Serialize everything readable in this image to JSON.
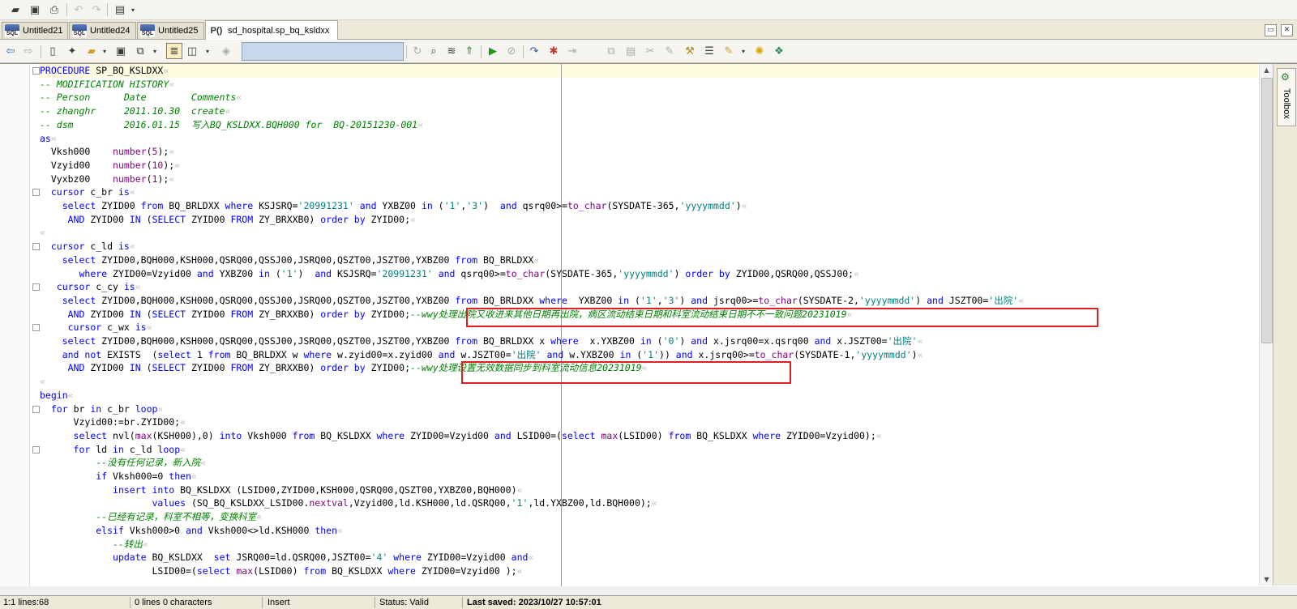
{
  "tabs": [
    {
      "label": "Untitled21",
      "type": "SQL"
    },
    {
      "label": "Untitled24",
      "type": "SQL"
    },
    {
      "label": "Untitled25",
      "type": "SQL"
    },
    {
      "label": "sd_hospital.sp_bq_ksldxx",
      "type": "P()"
    }
  ],
  "side_panel": {
    "toolbox_label": "Toolbox"
  },
  "status": {
    "position": "1:1 lines:68",
    "selection": "0 lines 0 characters",
    "mode": "Insert",
    "validity": "Status: Valid",
    "last_saved": "Last saved: 2023/10/27 10:57:01"
  },
  "code_lines": [
    {
      "segments": [
        {
          "t": "PROCEDURE",
          "c": "kw"
        },
        {
          "t": " SP_BQ_KSLDXX"
        },
        {
          "t": "«",
          "c": "para"
        }
      ]
    },
    {
      "segments": [
        {
          "t": "-- MODIFICATION HISTORY",
          "c": "cm"
        },
        {
          "t": "«",
          "c": "para"
        }
      ]
    },
    {
      "segments": [
        {
          "t": "-- Person      Date        Comments",
          "c": "cm"
        },
        {
          "t": "«",
          "c": "para"
        }
      ]
    },
    {
      "segments": [
        {
          "t": "-- zhanghr     2011.10.30  create",
          "c": "cm"
        },
        {
          "t": "«",
          "c": "para"
        }
      ]
    },
    {
      "segments": [
        {
          "t": "-- dsm         2016.01.15  写入BQ_KSLDXX.BQH000 for  BQ-20151230-001",
          "c": "cm"
        },
        {
          "t": "«",
          "c": "para"
        }
      ]
    },
    {
      "segments": [
        {
          "t": "as",
          "c": "kw"
        },
        {
          "t": "«",
          "c": "para"
        }
      ]
    },
    {
      "segments": [
        {
          "t": "  Vksh000    "
        },
        {
          "t": "number",
          "c": "fn"
        },
        {
          "t": "("
        },
        {
          "t": "5",
          "c": "num"
        },
        {
          "t": ");"
        },
        {
          "t": "«",
          "c": "para"
        }
      ]
    },
    {
      "segments": [
        {
          "t": "  Vzyid00    "
        },
        {
          "t": "number",
          "c": "fn"
        },
        {
          "t": "("
        },
        {
          "t": "10",
          "c": "num"
        },
        {
          "t": ");"
        },
        {
          "t": "«",
          "c": "para"
        }
      ]
    },
    {
      "segments": [
        {
          "t": "  Vyxbz00    "
        },
        {
          "t": "number",
          "c": "fn"
        },
        {
          "t": "("
        },
        {
          "t": "1",
          "c": "num"
        },
        {
          "t": ");"
        },
        {
          "t": "«",
          "c": "para"
        }
      ]
    },
    {
      "segments": [
        {
          "t": "  "
        },
        {
          "t": "cursor",
          "c": "kw"
        },
        {
          "t": " c_br "
        },
        {
          "t": "is",
          "c": "kw"
        },
        {
          "t": "«",
          "c": "para"
        }
      ]
    },
    {
      "segments": [
        {
          "t": "    "
        },
        {
          "t": "select",
          "c": "kw"
        },
        {
          "t": " ZYID00 "
        },
        {
          "t": "from",
          "c": "kw"
        },
        {
          "t": " BQ_BRLDXX "
        },
        {
          "t": "where",
          "c": "kw"
        },
        {
          "t": " KSJSRQ="
        },
        {
          "t": "'20991231'",
          "c": "str"
        },
        {
          "t": " "
        },
        {
          "t": "and",
          "c": "kw"
        },
        {
          "t": " YXBZ00 "
        },
        {
          "t": "in",
          "c": "kw"
        },
        {
          "t": " ("
        },
        {
          "t": "'1'",
          "c": "str"
        },
        {
          "t": ","
        },
        {
          "t": "'3'",
          "c": "str"
        },
        {
          "t": ")  "
        },
        {
          "t": "and",
          "c": "kw"
        },
        {
          "t": " qsrq00>="
        },
        {
          "t": "to_char",
          "c": "fn"
        },
        {
          "t": "(SYSDATE-365,"
        },
        {
          "t": "'yyyymmdd'",
          "c": "str"
        },
        {
          "t": ")"
        },
        {
          "t": "«",
          "c": "para"
        }
      ]
    },
    {
      "segments": [
        {
          "t": "     "
        },
        {
          "t": "AND",
          "c": "kw"
        },
        {
          "t": " ZYID00 "
        },
        {
          "t": "IN",
          "c": "kw"
        },
        {
          "t": " ("
        },
        {
          "t": "SELECT",
          "c": "kw"
        },
        {
          "t": " ZYID00 "
        },
        {
          "t": "FROM",
          "c": "kw"
        },
        {
          "t": " ZY_BRXXB0) "
        },
        {
          "t": "order by",
          "c": "kw"
        },
        {
          "t": " ZYID00;"
        },
        {
          "t": "«",
          "c": "para"
        }
      ]
    },
    {
      "segments": [
        {
          "t": "«",
          "c": "para"
        }
      ]
    },
    {
      "segments": [
        {
          "t": "  "
        },
        {
          "t": "cursor",
          "c": "kw"
        },
        {
          "t": " c_ld "
        },
        {
          "t": "is",
          "c": "kw"
        },
        {
          "t": "«",
          "c": "para"
        }
      ]
    },
    {
      "segments": [
        {
          "t": "    "
        },
        {
          "t": "select",
          "c": "kw"
        },
        {
          "t": " ZYID00,BQH000,KSH000,QSRQ00,QSSJ00,JSRQ00,QSZT00,JSZT00,YXBZ00 "
        },
        {
          "t": "from",
          "c": "kw"
        },
        {
          "t": " BQ_BRLDXX"
        },
        {
          "t": "«",
          "c": "para"
        }
      ]
    },
    {
      "segments": [
        {
          "t": "       "
        },
        {
          "t": "where",
          "c": "kw"
        },
        {
          "t": " ZYID00=Vzyid00 "
        },
        {
          "t": "and",
          "c": "kw"
        },
        {
          "t": " YXBZ00 "
        },
        {
          "t": "in",
          "c": "kw"
        },
        {
          "t": " ("
        },
        {
          "t": "'1'",
          "c": "str"
        },
        {
          "t": ")  "
        },
        {
          "t": "and",
          "c": "kw"
        },
        {
          "t": " KSJSRQ="
        },
        {
          "t": "'20991231'",
          "c": "str"
        },
        {
          "t": " "
        },
        {
          "t": "and",
          "c": "kw"
        },
        {
          "t": " qsrq00>="
        },
        {
          "t": "to_char",
          "c": "fn"
        },
        {
          "t": "(SYSDATE-365,"
        },
        {
          "t": "'yyyymmdd'",
          "c": "str"
        },
        {
          "t": ") "
        },
        {
          "t": "order by",
          "c": "kw"
        },
        {
          "t": " ZYID00,QSRQ00,QSSJ00;"
        },
        {
          "t": "«",
          "c": "para"
        }
      ]
    },
    {
      "segments": [
        {
          "t": "   "
        },
        {
          "t": "cursor",
          "c": "kw"
        },
        {
          "t": " c_cy "
        },
        {
          "t": "is",
          "c": "kw"
        },
        {
          "t": "«",
          "c": "para"
        }
      ]
    },
    {
      "segments": [
        {
          "t": "    "
        },
        {
          "t": "select",
          "c": "kw"
        },
        {
          "t": " ZYID00,BQH000,KSH000,QSRQ00,QSSJ00,JSRQ00,QSZT00,JSZT00,YXBZ00 "
        },
        {
          "t": "from",
          "c": "kw"
        },
        {
          "t": " BQ_BRLDXX "
        },
        {
          "t": "where",
          "c": "kw"
        },
        {
          "t": "  YXBZ00 "
        },
        {
          "t": "in",
          "c": "kw"
        },
        {
          "t": " ("
        },
        {
          "t": "'1'",
          "c": "str"
        },
        {
          "t": ","
        },
        {
          "t": "'3'",
          "c": "str"
        },
        {
          "t": ") "
        },
        {
          "t": "and",
          "c": "kw"
        },
        {
          "t": " jsrq00>="
        },
        {
          "t": "to_char",
          "c": "fn"
        },
        {
          "t": "(SYSDATE-2,"
        },
        {
          "t": "'yyyymmdd'",
          "c": "str"
        },
        {
          "t": ") "
        },
        {
          "t": "and",
          "c": "kw"
        },
        {
          "t": " JSZT00="
        },
        {
          "t": "'出院'",
          "c": "str"
        },
        {
          "t": "«",
          "c": "para"
        }
      ]
    },
    {
      "segments": [
        {
          "t": "     "
        },
        {
          "t": "AND",
          "c": "kw"
        },
        {
          "t": " ZYID00 "
        },
        {
          "t": "IN",
          "c": "kw"
        },
        {
          "t": " ("
        },
        {
          "t": "SELECT",
          "c": "kw"
        },
        {
          "t": " ZYID00 "
        },
        {
          "t": "FROM",
          "c": "kw"
        },
        {
          "t": " ZY_BRXXB0) "
        },
        {
          "t": "order by",
          "c": "kw"
        },
        {
          "t": " ZYID00;"
        },
        {
          "t": "--wwy处理出院又收进来其他日期再出院，病区流动结束日期和科室流动结束日期不不一致问题20231019",
          "c": "cm"
        },
        {
          "t": "«",
          "c": "para"
        }
      ]
    },
    {
      "segments": [
        {
          "t": "     "
        },
        {
          "t": "cursor",
          "c": "kw"
        },
        {
          "t": " c_wx "
        },
        {
          "t": "is",
          "c": "kw"
        },
        {
          "t": "«",
          "c": "para"
        }
      ]
    },
    {
      "segments": [
        {
          "t": "    "
        },
        {
          "t": "select",
          "c": "kw"
        },
        {
          "t": " ZYID00,BQH000,KSH000,QSRQ00,QSSJ00,JSRQ00,QSZT00,JSZT00,YXBZ00 "
        },
        {
          "t": "from",
          "c": "kw"
        },
        {
          "t": " BQ_BRLDXX x "
        },
        {
          "t": "where",
          "c": "kw"
        },
        {
          "t": "  x.YXBZ00 "
        },
        {
          "t": "in",
          "c": "kw"
        },
        {
          "t": " ("
        },
        {
          "t": "'0'",
          "c": "str"
        },
        {
          "t": ") "
        },
        {
          "t": "and",
          "c": "kw"
        },
        {
          "t": " x.jsrq00=x.qsrq00 "
        },
        {
          "t": "and",
          "c": "kw"
        },
        {
          "t": " x.JSZT00="
        },
        {
          "t": "'出院'",
          "c": "str"
        },
        {
          "t": "«",
          "c": "para"
        }
      ]
    },
    {
      "segments": [
        {
          "t": "    "
        },
        {
          "t": "and not",
          "c": "kw"
        },
        {
          "t": " EXISTS  ("
        },
        {
          "t": "select",
          "c": "kw"
        },
        {
          "t": " 1 "
        },
        {
          "t": "from",
          "c": "kw"
        },
        {
          "t": " BQ_BRLDXX w "
        },
        {
          "t": "where",
          "c": "kw"
        },
        {
          "t": " w.zyid00=x.zyid00 "
        },
        {
          "t": "and",
          "c": "kw"
        },
        {
          "t": " w.JSZT00="
        },
        {
          "t": "'出院'",
          "c": "str"
        },
        {
          "t": " "
        },
        {
          "t": "and",
          "c": "kw"
        },
        {
          "t": " w.YXBZ00 "
        },
        {
          "t": "in",
          "c": "kw"
        },
        {
          "t": " ("
        },
        {
          "t": "'1'",
          "c": "str"
        },
        {
          "t": ")) "
        },
        {
          "t": "and",
          "c": "kw"
        },
        {
          "t": " x.jsrq00>="
        },
        {
          "t": "to_char",
          "c": "fn"
        },
        {
          "t": "(SYSDATE-1,"
        },
        {
          "t": "'yyyymmdd'",
          "c": "str"
        },
        {
          "t": ")"
        },
        {
          "t": "«",
          "c": "para"
        }
      ]
    },
    {
      "segments": [
        {
          "t": "     "
        },
        {
          "t": "AND",
          "c": "kw"
        },
        {
          "t": " ZYID00 "
        },
        {
          "t": "IN",
          "c": "kw"
        },
        {
          "t": " ("
        },
        {
          "t": "SELECT",
          "c": "kw"
        },
        {
          "t": " ZYID00 "
        },
        {
          "t": "FROM",
          "c": "kw"
        },
        {
          "t": " ZY_BRXXB0) "
        },
        {
          "t": "order by",
          "c": "kw"
        },
        {
          "t": " ZYID00;"
        },
        {
          "t": "--wwy处理设置无效数据同步到科室流动信息20231019",
          "c": "cm"
        },
        {
          "t": "«",
          "c": "para"
        }
      ]
    },
    {
      "segments": [
        {
          "t": "«",
          "c": "para"
        }
      ]
    },
    {
      "segments": [
        {
          "t": "begin",
          "c": "kw"
        },
        {
          "t": "«",
          "c": "para"
        }
      ]
    },
    {
      "segments": [
        {
          "t": "  "
        },
        {
          "t": "for",
          "c": "kw"
        },
        {
          "t": " br "
        },
        {
          "t": "in",
          "c": "kw"
        },
        {
          "t": " c_br "
        },
        {
          "t": "loop",
          "c": "kw"
        },
        {
          "t": "«",
          "c": "para"
        }
      ]
    },
    {
      "segments": [
        {
          "t": "      Vzyid00:=br.ZYID00;"
        },
        {
          "t": "«",
          "c": "para"
        }
      ]
    },
    {
      "segments": [
        {
          "t": "      "
        },
        {
          "t": "select",
          "c": "kw"
        },
        {
          "t": " nvl("
        },
        {
          "t": "max",
          "c": "fn"
        },
        {
          "t": "(KSH000),0) "
        },
        {
          "t": "into",
          "c": "kw"
        },
        {
          "t": " Vksh000 "
        },
        {
          "t": "from",
          "c": "kw"
        },
        {
          "t": " BQ_KSLDXX "
        },
        {
          "t": "where",
          "c": "kw"
        },
        {
          "t": " ZYID00=Vzyid00 "
        },
        {
          "t": "and",
          "c": "kw"
        },
        {
          "t": " LSID00=("
        },
        {
          "t": "select",
          "c": "kw"
        },
        {
          "t": " "
        },
        {
          "t": "max",
          "c": "fn"
        },
        {
          "t": "(LSID00) "
        },
        {
          "t": "from",
          "c": "kw"
        },
        {
          "t": " BQ_KSLDXX "
        },
        {
          "t": "where",
          "c": "kw"
        },
        {
          "t": " ZYID00=Vzyid00);"
        },
        {
          "t": "«",
          "c": "para"
        }
      ]
    },
    {
      "segments": [
        {
          "t": "      "
        },
        {
          "t": "for",
          "c": "kw"
        },
        {
          "t": " ld "
        },
        {
          "t": "in",
          "c": "kw"
        },
        {
          "t": " c_ld "
        },
        {
          "t": "loop",
          "c": "kw"
        },
        {
          "t": "«",
          "c": "para"
        }
      ]
    },
    {
      "segments": [
        {
          "t": "          "
        },
        {
          "t": "--没有任何记录，新入院",
          "c": "cm"
        },
        {
          "t": "«",
          "c": "para"
        }
      ]
    },
    {
      "segments": [
        {
          "t": "          "
        },
        {
          "t": "if",
          "c": "kw"
        },
        {
          "t": " Vksh000=0 "
        },
        {
          "t": "then",
          "c": "kw"
        },
        {
          "t": "«",
          "c": "para"
        }
      ]
    },
    {
      "segments": [
        {
          "t": "             "
        },
        {
          "t": "insert into",
          "c": "kw"
        },
        {
          "t": " BQ_KSLDXX (LSID00,ZYID00,KSH000,QSRQ00,QSZT00,YXBZ00,BQH000)"
        },
        {
          "t": "«",
          "c": "para"
        }
      ]
    },
    {
      "segments": [
        {
          "t": "                    "
        },
        {
          "t": "values",
          "c": "kw"
        },
        {
          "t": " (SQ_BQ_KSLDXX_LSID00."
        },
        {
          "t": "nextval",
          "c": "fn"
        },
        {
          "t": ",Vzyid00,ld.KSH000,ld.QSRQ00,"
        },
        {
          "t": "'1'",
          "c": "str"
        },
        {
          "t": ",ld.YXBZ00,ld.BQH000);"
        },
        {
          "t": "«",
          "c": "para"
        }
      ]
    },
    {
      "segments": [
        {
          "t": "          "
        },
        {
          "t": "--已经有记录，科室不相等，变换科室",
          "c": "cm"
        },
        {
          "t": "«",
          "c": "para"
        }
      ]
    },
    {
      "segments": [
        {
          "t": "          "
        },
        {
          "t": "elsif",
          "c": "kw"
        },
        {
          "t": " Vksh000>0 "
        },
        {
          "t": "and",
          "c": "kw"
        },
        {
          "t": " Vksh000<>ld.KSH000 "
        },
        {
          "t": "then",
          "c": "kw"
        },
        {
          "t": "«",
          "c": "para"
        }
      ]
    },
    {
      "segments": [
        {
          "t": "             "
        },
        {
          "t": "--转出",
          "c": "cm"
        },
        {
          "t": "«",
          "c": "para"
        }
      ]
    },
    {
      "segments": [
        {
          "t": "             "
        },
        {
          "t": "update",
          "c": "kw"
        },
        {
          "t": " BQ_KSLDXX  "
        },
        {
          "t": "set",
          "c": "kw"
        },
        {
          "t": " JSRQ00=ld.QSRQ00,JSZT00="
        },
        {
          "t": "'4'",
          "c": "str"
        },
        {
          "t": " "
        },
        {
          "t": "where",
          "c": "kw"
        },
        {
          "t": " ZYID00=Vzyid00 "
        },
        {
          "t": "and",
          "c": "kw"
        },
        {
          "t": "«",
          "c": "para"
        }
      ]
    },
    {
      "segments": [
        {
          "t": "                    LSID00=("
        },
        {
          "t": "select",
          "c": "kw"
        },
        {
          "t": " "
        },
        {
          "t": "max",
          "c": "fn"
        },
        {
          "t": "(LSID00) "
        },
        {
          "t": "from",
          "c": "kw"
        },
        {
          "t": " BQ_KSLDXX "
        },
        {
          "t": "where",
          "c": "kw"
        },
        {
          "t": " ZYID00=Vzyid00 );"
        },
        {
          "t": "«",
          "c": "para"
        }
      ]
    }
  ]
}
